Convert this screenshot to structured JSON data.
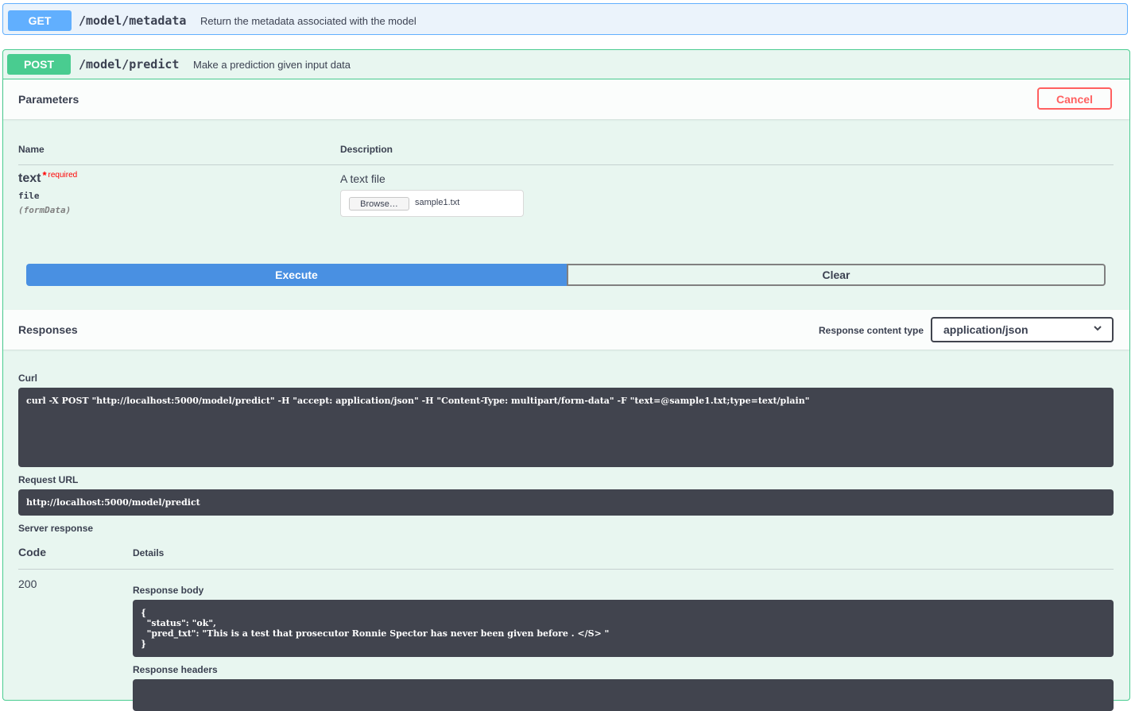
{
  "get_op": {
    "method": "GET",
    "path": "/model/metadata",
    "summary": "Return the metadata associated with the model"
  },
  "post_op": {
    "method": "POST",
    "path": "/model/predict",
    "summary": "Make a prediction given input data"
  },
  "parameters": {
    "title": "Parameters",
    "cancel_label": "Cancel",
    "col_name": "Name",
    "col_description": "Description",
    "param": {
      "name": "text",
      "star": "*",
      "required_label": "required",
      "type": "file",
      "in": "(formData)",
      "description": "A text file",
      "browse_label": "Browse…",
      "file_name": "sample1.txt"
    },
    "execute_label": "Execute",
    "clear_label": "Clear"
  },
  "responses": {
    "title": "Responses",
    "content_type_label": "Response content type",
    "content_type_value": "application/json",
    "curl_label": "Curl",
    "curl_command": "curl -X POST \"http://localhost:5000/model/predict\" -H \"accept: application/json\" -H \"Content-Type: multipart/form-data\" -F \"text=@sample1.txt;type=text/plain\"",
    "request_url_label": "Request URL",
    "request_url": "http://localhost:5000/model/predict",
    "server_response_label": "Server response",
    "code_header": "Code",
    "details_header": "Details",
    "code": "200",
    "response_body_label": "Response body",
    "response_body": "{\n  \"status\": \"ok\",\n  \"pred_txt\": \"This is a test that prosecutor Ronnie Spector has never been given before . </S> \"\n}",
    "response_headers_label": "Response headers"
  },
  "colors": {
    "get": "#61affe",
    "post": "#49cc90",
    "cancel": "#ff6060",
    "execute": "#4990e2",
    "code_bg": "#41444e"
  }
}
